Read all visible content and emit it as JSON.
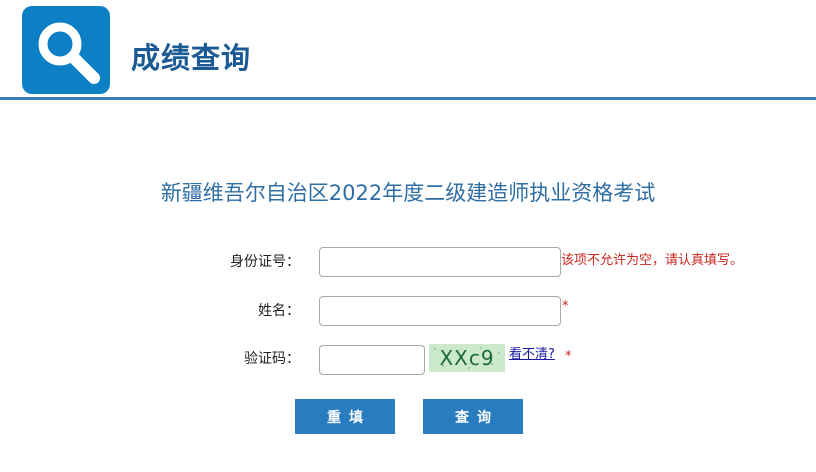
{
  "header": {
    "title": "成绩查询",
    "logo_icon": "magnifier-icon",
    "accent_color": "#0d7fc4"
  },
  "exam_title": "新疆维吾尔自治区2022年度二级建造师执业资格考试",
  "form": {
    "id_label": "身份证号：",
    "id_value": "",
    "id_error": "该项不允许为空，请认真填写。",
    "name_label": "姓名：",
    "name_value": "",
    "name_required_mark": "*",
    "captcha_label": "验证码：",
    "captcha_value": "",
    "captcha_image_text": "XXc9",
    "captcha_refresh_label": "看不清?",
    "captcha_required_mark": "*"
  },
  "buttons": {
    "reset_label": "重填",
    "query_label": "查询"
  }
}
